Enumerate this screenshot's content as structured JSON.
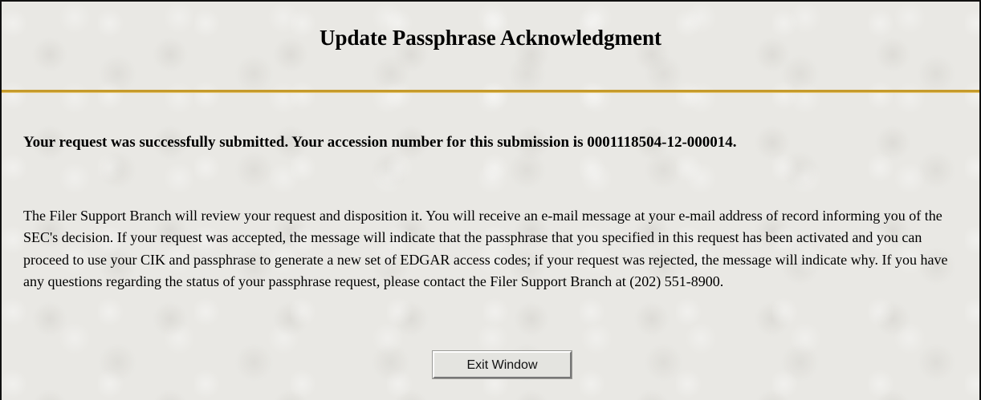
{
  "page": {
    "title": "Update Passphrase Acknowledgment",
    "confirmation_message": "Your request was successfully submitted. Your accession number for this submission is 0001118504-12-000014.",
    "details_message": "The Filer Support Branch will review your request and disposition it. You will receive an e-mail message at your e-mail address of record informing you of the SEC's decision. If your request was accepted, the message will indicate that the passphrase that you specified in this request has been activated and you can proceed to use your CIK and passphrase to generate a new set of EDGAR access codes; if your request was rejected, the message will indicate why. If you have any questions regarding the status of your passphrase request, please contact the Filer Support Branch at (202) 551-8900."
  },
  "actions": {
    "exit_label": "Exit Window"
  },
  "colors": {
    "background": "#e9e8e4",
    "divider": "#c59a2a",
    "border": "#111111"
  }
}
